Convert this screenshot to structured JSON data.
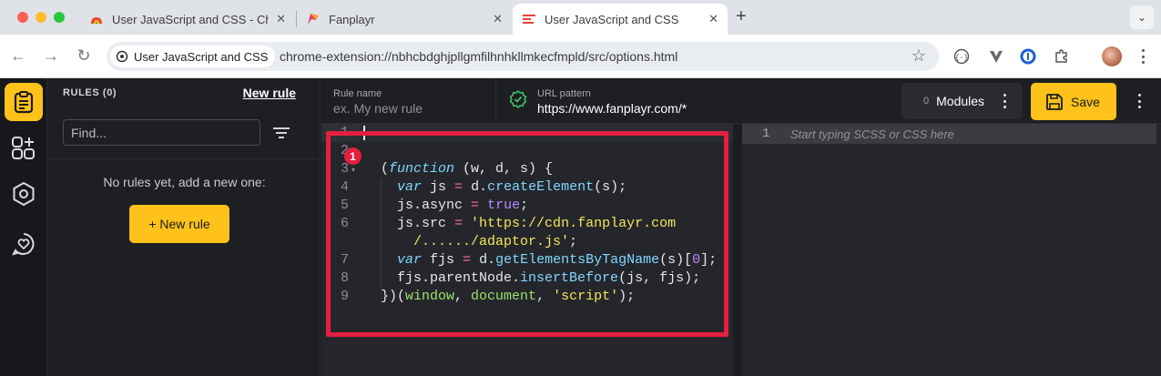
{
  "browser": {
    "tabs": [
      {
        "title": "User JavaScript and CSS - Chrome Web Store",
        "active": false
      },
      {
        "title": "Fanplayr",
        "active": false
      },
      {
        "title": "User JavaScript and CSS",
        "active": true
      }
    ],
    "new_tab_glyph": "+",
    "address_chip": "User JavaScript and CSS",
    "url": "chrome-extension://nbhcbdghjpllgmfilhnhkllmkecfmpld/src/options.html"
  },
  "sidebar": {
    "icons": [
      "clipboard-icon",
      "apps-add-icon",
      "hexagon-settings-icon",
      "heart-chat-icon"
    ]
  },
  "rules_panel": {
    "title": "RULES (0)",
    "new_rule_link": "New rule",
    "find_placeholder": "Find...",
    "empty_text": "No rules yet, add a new one:",
    "new_rule_button": "+ New rule"
  },
  "rule_header": {
    "rule_name_label": "Rule name",
    "rule_name_placeholder": "ex. My new rule",
    "url_pattern_label": "URL pattern",
    "url_pattern_value": "https://www.fanplayr.com/*",
    "modules_count": "0",
    "modules_label": "Modules",
    "save_label": "Save"
  },
  "js_editor": {
    "line_numbers": [
      "1",
      "2",
      "3",
      "4",
      "5",
      "6",
      "",
      "7",
      "8",
      "9"
    ],
    "badge": "1"
  },
  "css_editor": {
    "line_number": "1",
    "placeholder": "Start typing SCSS or CSS here"
  },
  "colors": {
    "accent": "#ffc21a",
    "highlight_box": "#e51f3e",
    "keyword": "#7fd8ff",
    "string": "#f3e65b",
    "number": "#b68cff",
    "operator": "#ff6b9b",
    "global": "#9be26b"
  }
}
